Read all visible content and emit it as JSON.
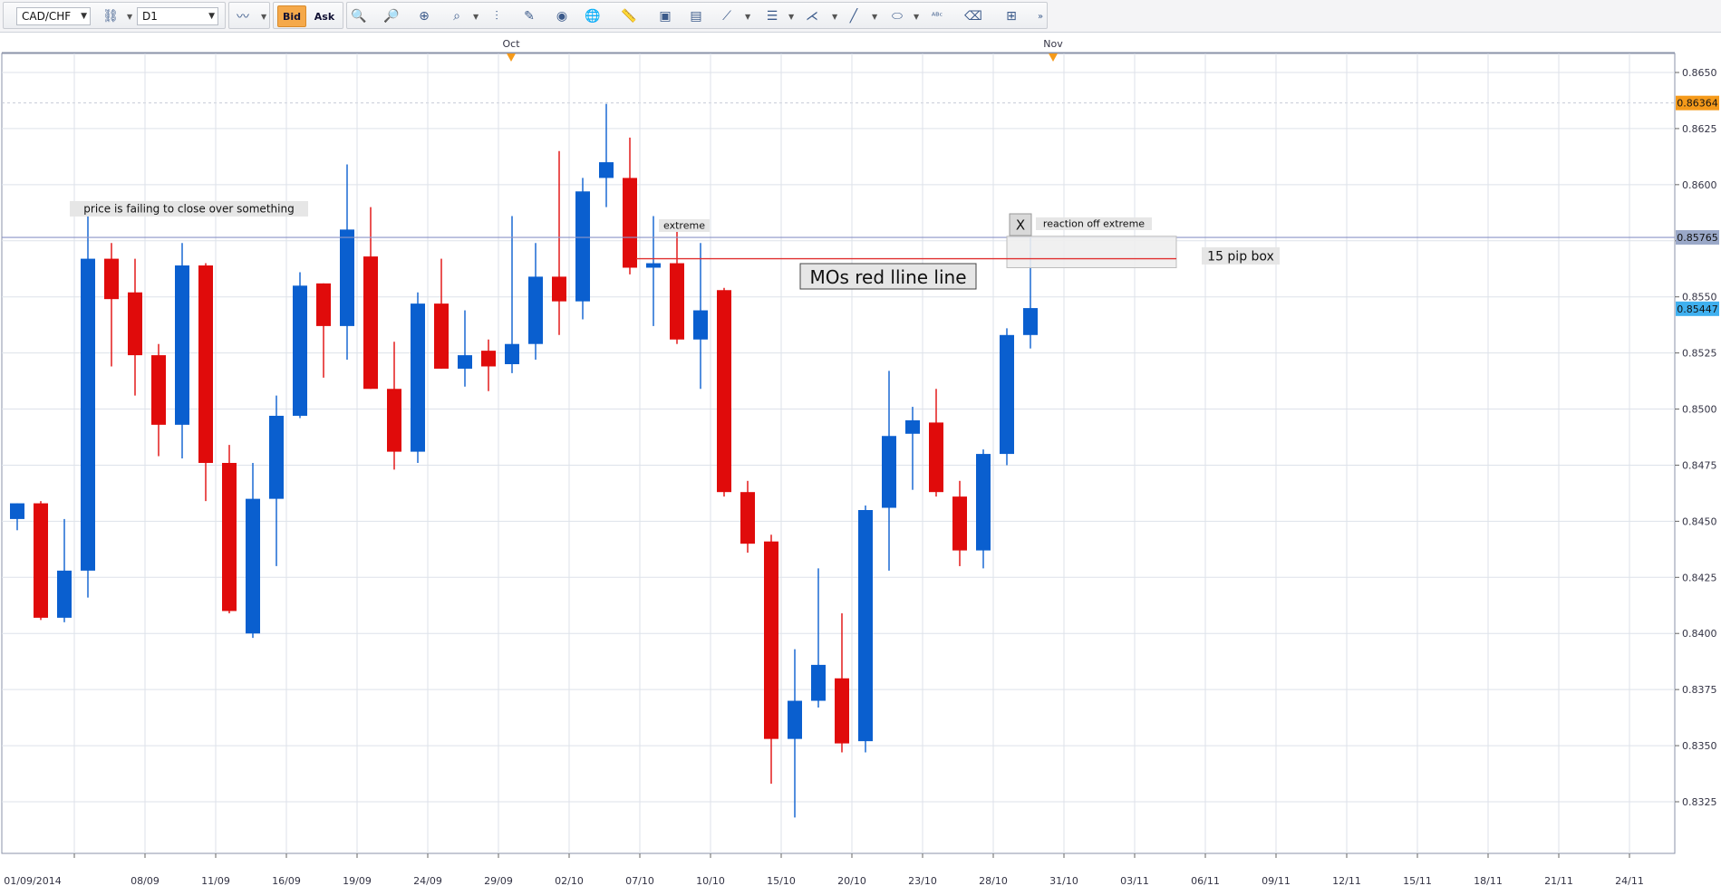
{
  "toolbar": {
    "symbol": "CAD/CHF",
    "timeframe": "D1",
    "bid_label": "Bid",
    "ask_label": "Ask"
  },
  "colors": {
    "bull": "#0a5fcf",
    "bear": "#e00b0b",
    "grid": "#dde2ea",
    "axis_text": "#333344",
    "price_badge_bg": "#f59a1a",
    "bid_badge_bg": "#3fb0ef",
    "line_badge_bg": "#9aa8c8",
    "hline": "#8c94c8",
    "red_line": "#e03030"
  },
  "chart_data": {
    "type": "candlestick",
    "symbol": "CAD/CHF",
    "timeframe": "D1",
    "ylim": [
      0.8305,
      0.8657
    ],
    "y_ticks": [
      "0.8325",
      "0.8350",
      "0.8375",
      "0.8400",
      "0.8425",
      "0.8450",
      "0.8475",
      "0.8500",
      "0.8525",
      "0.8550",
      "0.8575",
      "0.8600",
      "0.8625",
      "0.8650"
    ],
    "x_labels": [
      "01/09/2014",
      "08/09",
      "11/09",
      "16/09",
      "19/09",
      "24/09",
      "29/09",
      "02/10",
      "07/10",
      "10/10",
      "15/10",
      "20/10",
      "23/10",
      "28/10",
      "31/10",
      "03/11",
      "06/11",
      "09/11",
      "12/11",
      "15/11",
      "18/11",
      "21/11",
      "24/11"
    ],
    "month_labels": [
      {
        "label": "Oct",
        "bar": 21
      },
      {
        "label": "Nov",
        "bar": 44
      }
    ],
    "candles": [
      {
        "o": 0.8451,
        "h": 0.8458,
        "l": 0.8446,
        "c": 0.8458
      },
      {
        "o": 0.8458,
        "h": 0.8459,
        "l": 0.8406,
        "c": 0.8407
      },
      {
        "o": 0.8407,
        "h": 0.8451,
        "l": 0.8405,
        "c": 0.8428
      },
      {
        "o": 0.8428,
        "h": 0.8586,
        "l": 0.8416,
        "c": 0.8567
      },
      {
        "o": 0.8567,
        "h": 0.8574,
        "l": 0.8519,
        "c": 0.8549
      },
      {
        "o": 0.8552,
        "h": 0.8567,
        "l": 0.8506,
        "c": 0.8524
      },
      {
        "o": 0.8524,
        "h": 0.8529,
        "l": 0.8479,
        "c": 0.8493
      },
      {
        "o": 0.8493,
        "h": 0.8574,
        "l": 0.8478,
        "c": 0.8564
      },
      {
        "o": 0.8564,
        "h": 0.8565,
        "l": 0.8459,
        "c": 0.8476
      },
      {
        "o": 0.8476,
        "h": 0.8484,
        "l": 0.8409,
        "c": 0.841
      },
      {
        "o": 0.84,
        "h": 0.8476,
        "l": 0.8398,
        "c": 0.846
      },
      {
        "o": 0.846,
        "h": 0.8506,
        "l": 0.843,
        "c": 0.8497
      },
      {
        "o": 0.8497,
        "h": 0.8561,
        "l": 0.8496,
        "c": 0.8555
      },
      {
        "o": 0.8556,
        "h": 0.8556,
        "l": 0.8514,
        "c": 0.8537
      },
      {
        "o": 0.8537,
        "h": 0.8609,
        "l": 0.8522,
        "c": 0.858
      },
      {
        "o": 0.8568,
        "h": 0.859,
        "l": 0.8509,
        "c": 0.8509
      },
      {
        "o": 0.8509,
        "h": 0.853,
        "l": 0.8473,
        "c": 0.8481
      },
      {
        "o": 0.8481,
        "h": 0.8552,
        "l": 0.8476,
        "c": 0.8547
      },
      {
        "o": 0.8547,
        "h": 0.8567,
        "l": 0.8518,
        "c": 0.8518
      },
      {
        "o": 0.8518,
        "h": 0.8544,
        "l": 0.851,
        "c": 0.8524
      },
      {
        "o": 0.8526,
        "h": 0.8531,
        "l": 0.8508,
        "c": 0.8519
      },
      {
        "o": 0.852,
        "h": 0.8586,
        "l": 0.8516,
        "c": 0.8529
      },
      {
        "o": 0.8529,
        "h": 0.8574,
        "l": 0.8522,
        "c": 0.8559
      },
      {
        "o": 0.8559,
        "h": 0.8615,
        "l": 0.8533,
        "c": 0.8548
      },
      {
        "o": 0.8548,
        "h": 0.8603,
        "l": 0.854,
        "c": 0.8597
      },
      {
        "o": 0.8603,
        "h": 0.8636,
        "l": 0.859,
        "c": 0.861
      },
      {
        "o": 0.8603,
        "h": 0.8621,
        "l": 0.856,
        "c": 0.8563
      },
      {
        "o": 0.8563,
        "h": 0.8586,
        "l": 0.8537,
        "c": 0.8565
      },
      {
        "o": 0.8565,
        "h": 0.8579,
        "l": 0.8529,
        "c": 0.8531
      },
      {
        "o": 0.8531,
        "h": 0.8574,
        "l": 0.8509,
        "c": 0.8544
      },
      {
        "o": 0.8553,
        "h": 0.8554,
        "l": 0.8461,
        "c": 0.8463
      },
      {
        "o": 0.8463,
        "h": 0.8468,
        "l": 0.8436,
        "c": 0.844
      },
      {
        "o": 0.8441,
        "h": 0.8444,
        "l": 0.8333,
        "c": 0.8353
      },
      {
        "o": 0.8353,
        "h": 0.8393,
        "l": 0.8318,
        "c": 0.837
      },
      {
        "o": 0.837,
        "h": 0.8429,
        "l": 0.8367,
        "c": 0.8386
      },
      {
        "o": 0.838,
        "h": 0.8409,
        "l": 0.8347,
        "c": 0.8351
      },
      {
        "o": 0.8352,
        "h": 0.8457,
        "l": 0.8347,
        "c": 0.8455
      },
      {
        "o": 0.8456,
        "h": 0.8517,
        "l": 0.8428,
        "c": 0.8488
      },
      {
        "o": 0.8489,
        "h": 0.8501,
        "l": 0.8464,
        "c": 0.8495
      },
      {
        "o": 0.8494,
        "h": 0.8509,
        "l": 0.8461,
        "c": 0.8463
      },
      {
        "o": 0.8461,
        "h": 0.8468,
        "l": 0.843,
        "c": 0.8437
      },
      {
        "o": 0.8437,
        "h": 0.8482,
        "l": 0.8429,
        "c": 0.848
      },
      {
        "o": 0.848,
        "h": 0.8536,
        "l": 0.8475,
        "c": 0.8533
      },
      {
        "o": 0.8533,
        "h": 0.8577,
        "l": 0.8527,
        "c": 0.8545
      }
    ],
    "annotations": {
      "blue_hline_value": "0.85765",
      "current_bid": "0.85447",
      "top_marker": "0.86364",
      "label_failing": "price is failing to close over something",
      "label_extreme": "extreme",
      "label_reaction": "reaction off extreme",
      "label_x": "X",
      "label_pip_box": "15 pip box",
      "label_mos": "MOs red lline line"
    }
  }
}
